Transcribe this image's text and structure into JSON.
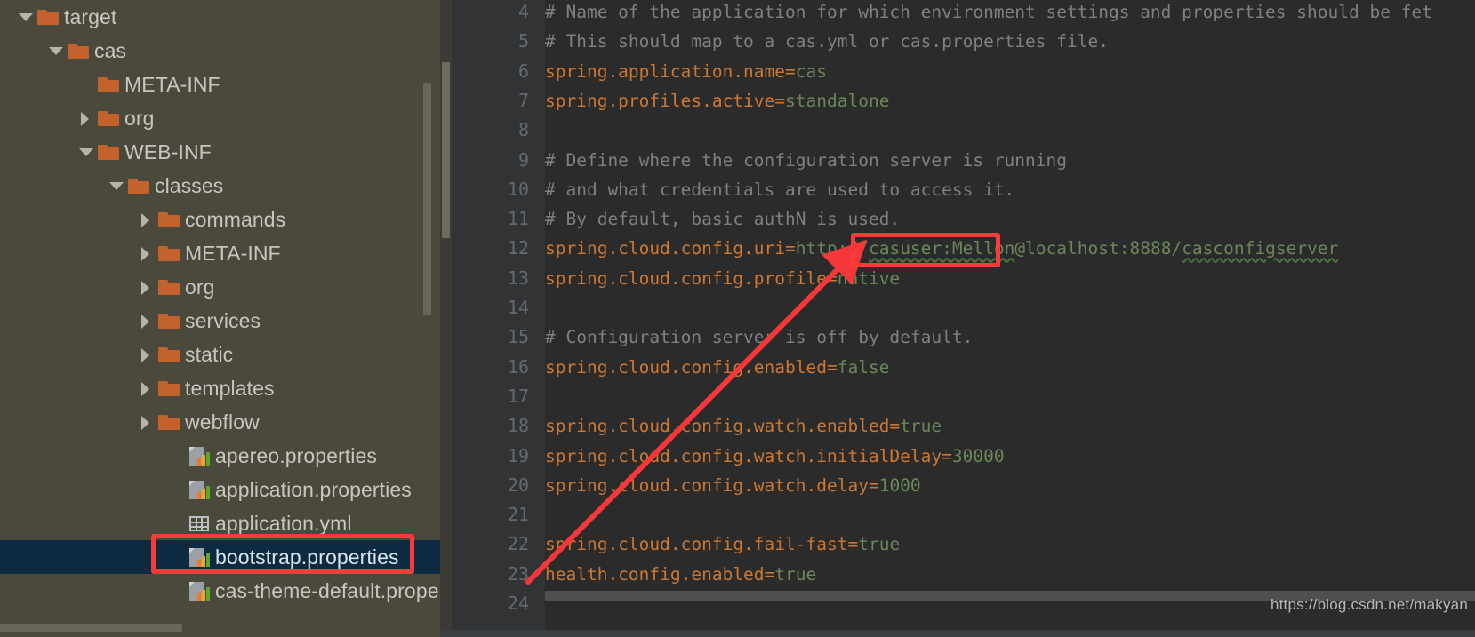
{
  "theme": {
    "sidebar_bg": "#4b483c",
    "editor_bg": "#2b2b2b",
    "gutter_bg": "#313335",
    "selection_bg": "#0d2a40",
    "folder_color": "#c4622d",
    "annotation_red": "#fb3b3b",
    "key_color": "#cc7832",
    "value_color": "#6a8759",
    "comment_color": "#808080",
    "line_number_color": "#666a6d"
  },
  "file_tree": {
    "items": [
      {
        "label": "target",
        "type": "folder",
        "twisty": "down",
        "depth": 0,
        "selected": false,
        "icon": "folder-icon"
      },
      {
        "label": "cas",
        "type": "folder",
        "twisty": "down",
        "depth": 1,
        "selected": false,
        "icon": "folder-icon"
      },
      {
        "label": "META-INF",
        "type": "folder",
        "twisty": "none",
        "depth": 2,
        "selected": false,
        "icon": "folder-icon"
      },
      {
        "label": "org",
        "type": "folder",
        "twisty": "right",
        "depth": 2,
        "selected": false,
        "icon": "folder-icon"
      },
      {
        "label": "WEB-INF",
        "type": "folder",
        "twisty": "down",
        "depth": 2,
        "selected": false,
        "icon": "folder-icon"
      },
      {
        "label": "classes",
        "type": "folder",
        "twisty": "down",
        "depth": 3,
        "selected": false,
        "icon": "folder-icon"
      },
      {
        "label": "commands",
        "type": "folder",
        "twisty": "right",
        "depth": 4,
        "selected": false,
        "icon": "folder-icon"
      },
      {
        "label": "META-INF",
        "type": "folder",
        "twisty": "right",
        "depth": 4,
        "selected": false,
        "icon": "folder-icon"
      },
      {
        "label": "org",
        "type": "folder",
        "twisty": "right",
        "depth": 4,
        "selected": false,
        "icon": "folder-icon"
      },
      {
        "label": "services",
        "type": "folder",
        "twisty": "right",
        "depth": 4,
        "selected": false,
        "icon": "folder-icon"
      },
      {
        "label": "static",
        "type": "folder",
        "twisty": "right",
        "depth": 4,
        "selected": false,
        "icon": "folder-icon"
      },
      {
        "label": "templates",
        "type": "folder",
        "twisty": "right",
        "depth": 4,
        "selected": false,
        "icon": "folder-icon"
      },
      {
        "label": "webflow",
        "type": "folder",
        "twisty": "right",
        "depth": 4,
        "selected": false,
        "icon": "folder-icon"
      },
      {
        "label": "apereo.properties",
        "type": "props",
        "twisty": "none",
        "depth": 5,
        "selected": false,
        "icon": "properties-file-icon"
      },
      {
        "label": "application.properties",
        "type": "props",
        "twisty": "none",
        "depth": 5,
        "selected": false,
        "icon": "properties-file-icon"
      },
      {
        "label": "application.yml",
        "type": "yml",
        "twisty": "none",
        "depth": 5,
        "selected": false,
        "icon": "yaml-file-icon"
      },
      {
        "label": "bootstrap.properties",
        "type": "props",
        "twisty": "none",
        "depth": 5,
        "selected": true,
        "icon": "properties-file-icon"
      },
      {
        "label": "cas-theme-default.proper",
        "type": "props",
        "twisty": "none",
        "depth": 5,
        "selected": false,
        "icon": "properties-file-icon"
      }
    ]
  },
  "editor": {
    "first_visible_line": 4,
    "lines": [
      {
        "n": 4,
        "tokens": [
          {
            "t": "comment",
            "s": "# Name of the application for which environment settings and properties should be fet"
          }
        ]
      },
      {
        "n": 5,
        "tokens": [
          {
            "t": "comment",
            "s": "# This should map to a cas.yml or cas.properties file."
          }
        ]
      },
      {
        "n": 6,
        "tokens": [
          {
            "t": "key",
            "s": "spring.application.name"
          },
          {
            "t": "eq",
            "s": "="
          },
          {
            "t": "val",
            "s": "cas"
          }
        ]
      },
      {
        "n": 7,
        "tokens": [
          {
            "t": "key",
            "s": "spring.profiles.active"
          },
          {
            "t": "eq",
            "s": "="
          },
          {
            "t": "val",
            "s": "standalone"
          }
        ]
      },
      {
        "n": 8,
        "tokens": []
      },
      {
        "n": 9,
        "tokens": [
          {
            "t": "comment",
            "s": "# Define where the configuration server is running"
          }
        ]
      },
      {
        "n": 10,
        "tokens": [
          {
            "t": "comment",
            "s": "# and what credentials are used to access it."
          }
        ]
      },
      {
        "n": 11,
        "tokens": [
          {
            "t": "comment",
            "s": "# By default, basic authN is used."
          }
        ]
      },
      {
        "n": 12,
        "tokens": [
          {
            "t": "key",
            "s": "spring.cloud.config.uri"
          },
          {
            "t": "eq",
            "s": "="
          },
          {
            "t": "val",
            "s": "http://"
          },
          {
            "t": "val-squiggle",
            "s": "casuser:Mellon"
          },
          {
            "t": "val",
            "s": "@localhost:8888/"
          },
          {
            "t": "val-squiggle",
            "s": "casconfigserver"
          }
        ]
      },
      {
        "n": 13,
        "tokens": [
          {
            "t": "key",
            "s": "spring.cloud.config.profile"
          },
          {
            "t": "eq",
            "s": "="
          },
          {
            "t": "val",
            "s": "native"
          }
        ]
      },
      {
        "n": 14,
        "tokens": []
      },
      {
        "n": 15,
        "tokens": [
          {
            "t": "comment",
            "s": "# Configuration server is off by default."
          }
        ]
      },
      {
        "n": 16,
        "tokens": [
          {
            "t": "key",
            "s": "spring.cloud.config.enabled"
          },
          {
            "t": "eq",
            "s": "="
          },
          {
            "t": "val",
            "s": "false"
          }
        ]
      },
      {
        "n": 17,
        "tokens": []
      },
      {
        "n": 18,
        "tokens": [
          {
            "t": "key",
            "s": "spring.cloud.config.watch.enabled"
          },
          {
            "t": "eq",
            "s": "="
          },
          {
            "t": "val",
            "s": "true"
          }
        ]
      },
      {
        "n": 19,
        "tokens": [
          {
            "t": "key",
            "s": "spring.cloud.config.watch.initialDelay"
          },
          {
            "t": "eq",
            "s": "="
          },
          {
            "t": "val",
            "s": "30000"
          }
        ]
      },
      {
        "n": 20,
        "tokens": [
          {
            "t": "key",
            "s": "spring.cloud.config.watch.delay"
          },
          {
            "t": "eq",
            "s": "="
          },
          {
            "t": "val",
            "s": "1000"
          }
        ]
      },
      {
        "n": 21,
        "tokens": []
      },
      {
        "n": 22,
        "tokens": [
          {
            "t": "key",
            "s": "spring.cloud.config.fail-fast"
          },
          {
            "t": "eq",
            "s": "="
          },
          {
            "t": "val",
            "s": "true"
          }
        ]
      },
      {
        "n": 23,
        "tokens": [
          {
            "t": "key",
            "s": "health.config.enabled"
          },
          {
            "t": "eq",
            "s": "="
          },
          {
            "t": "val",
            "s": "true"
          }
        ]
      },
      {
        "n": 24,
        "tokens": []
      }
    ]
  },
  "annotations": {
    "file_highlight_target": "bootstrap.properties",
    "credentials_highlight_target": "casuser:Mellon",
    "arrow": {
      "from": "bootstrap.properties",
      "to": "casuser:Mellon"
    }
  },
  "watermark": {
    "text": "https://blog.csdn.net/makyan"
  }
}
